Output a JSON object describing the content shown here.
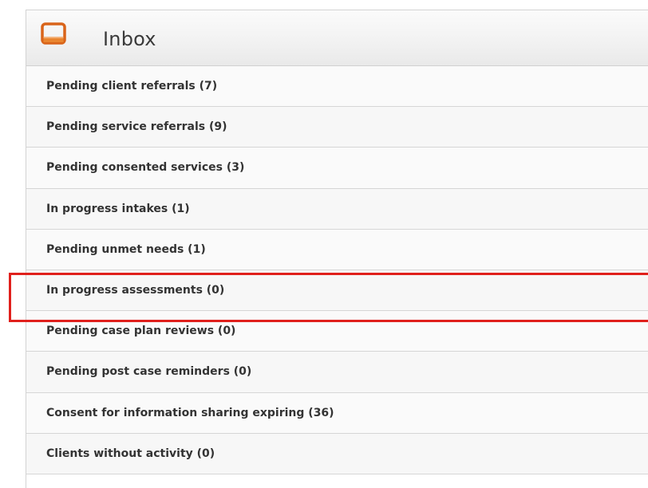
{
  "inbox": {
    "title": "Inbox",
    "icon": "inbox-tray-icon",
    "icon_color": "#e2731f",
    "items": [
      {
        "label": "Pending client referrals (7)"
      },
      {
        "label": "Pending service referrals (9)"
      },
      {
        "label": "Pending consented services (3)"
      },
      {
        "label": "In progress intakes (1)"
      },
      {
        "label": "Pending unmet needs (1)"
      },
      {
        "label": "In progress assessments (0)"
      },
      {
        "label": "Pending case plan reviews (0)"
      },
      {
        "label": "Pending post case reminders (0)"
      },
      {
        "label": "Consent for information sharing expiring (36)"
      },
      {
        "label": "Clients without activity (0)"
      }
    ]
  },
  "highlight": {
    "color": "#e0201c",
    "target": "In progress assessments (0)"
  }
}
